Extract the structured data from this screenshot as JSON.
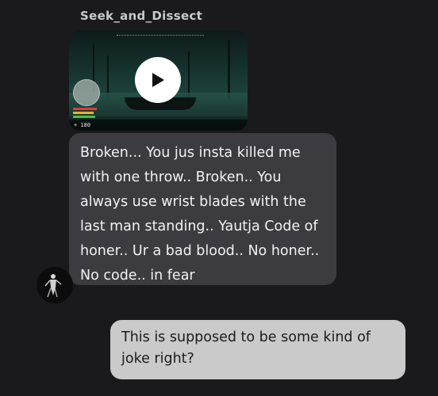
{
  "conversation": {
    "sender_name": "Seek_and_Dissect",
    "video": {
      "hud_count": "+ 180",
      "play_icon": "play-icon"
    },
    "received_message": "Broken... You jus insta killed me with one throw.. Broken.. You always use wrist blades with the last man standing.. Yautja Code of honer.. Ur a bad blood.. No honer.. No code.. in fear",
    "sent_message": "This is supposed to be some kind of joke right?"
  },
  "colors": {
    "background": "#1a1a1c",
    "received_bubble": "#3c3c40",
    "sent_bubble": "#cacaca"
  }
}
